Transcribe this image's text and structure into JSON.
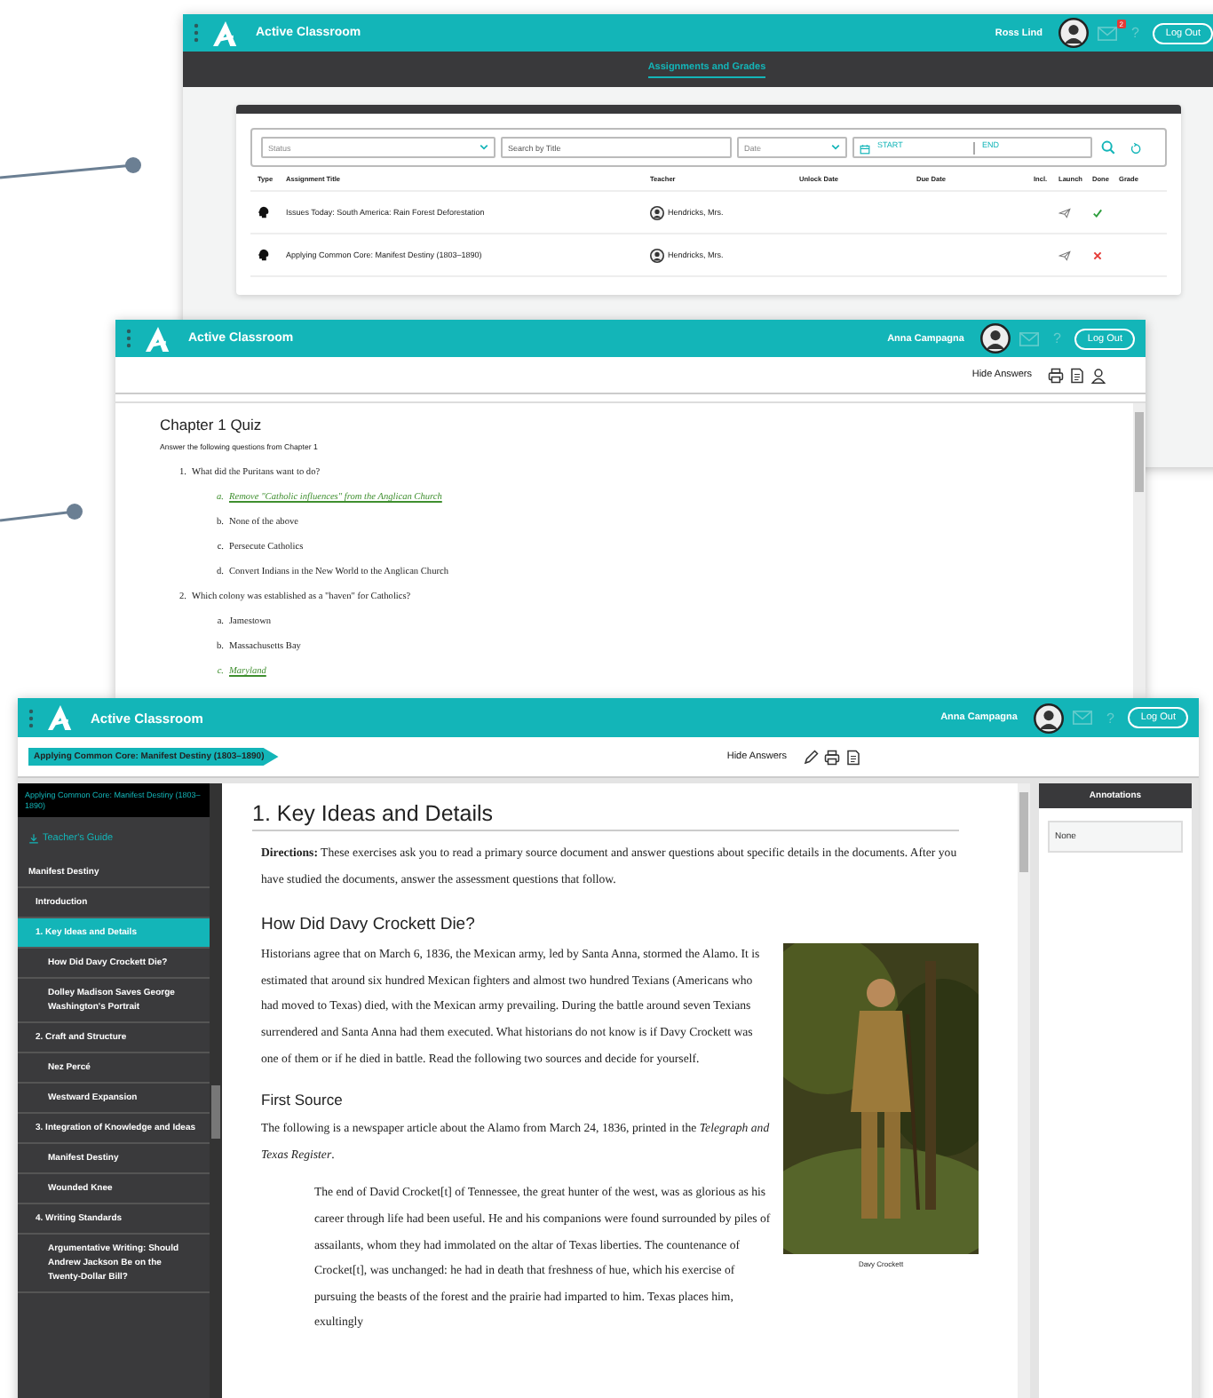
{
  "grades_window": {
    "app_title": "Active Classroom",
    "user_name": "Ross Lind",
    "mail_badge": "2",
    "help": "?",
    "logout": "Log Out",
    "nav_tab": "Assignments and Grades",
    "filters": {
      "status": {
        "placeholder": "Status"
      },
      "search": {
        "placeholder": "Search by Title"
      },
      "date": {
        "placeholder": "Date"
      },
      "start_label": "START",
      "end_label": "END"
    },
    "table": {
      "columns": [
        "Type",
        "Assignment Title",
        "Teacher",
        "Unlock Date",
        "Due Date",
        "Incl.",
        "Launch",
        "Done",
        "Grade"
      ],
      "rows": [
        {
          "title": "Issues Today: South America: Rain Forest Deforestation",
          "teacher": "Hendricks, Mrs.",
          "done": true
        },
        {
          "title": "Applying Common Core: Manifest Destiny (1803–1890)",
          "teacher": "Hendricks, Mrs.",
          "done": false
        }
      ]
    }
  },
  "quiz_window": {
    "app_title": "Active Classroom",
    "user_name": "Anna Campagna",
    "help": "?",
    "logout": "Log Out",
    "hide_answers": "Hide Answers",
    "title": "Chapter 1 Quiz",
    "instructions": "Answer the following questions from Chapter 1",
    "questions": [
      {
        "number": "1.",
        "text": "What did the Puritans want to do?",
        "options": [
          {
            "letter": "a.",
            "text": "Remove \"Catholic influences\" from the Anglican Church",
            "correct": true
          },
          {
            "letter": "b.",
            "text": "None of the above",
            "correct": false
          },
          {
            "letter": "c.",
            "text": "Persecute Catholics",
            "correct": false
          },
          {
            "letter": "d.",
            "text": "Convert Indians in the New World to the Anglican Church",
            "correct": false
          }
        ]
      },
      {
        "number": "2.",
        "text": "Which colony was established as a \"haven\" for Catholics?",
        "options": [
          {
            "letter": "a.",
            "text": "Jamestown",
            "correct": false
          },
          {
            "letter": "b.",
            "text": "Massachusetts Bay",
            "correct": false
          },
          {
            "letter": "c.",
            "text": "Maryland",
            "correct": true
          }
        ]
      }
    ]
  },
  "reader_window": {
    "app_title": "Active Classroom",
    "user_name": "Anna Campagna",
    "help": "?",
    "logout": "Log Out",
    "breadcrumb": "Applying Common Core: Manifest Destiny (1803–1890)",
    "hide_answers": "Hide Answers",
    "sidebar": {
      "book_title": "Applying Common Core: Manifest Destiny (1803–1890)",
      "teachers_guide": "Teacher's Guide",
      "items": [
        {
          "label": "Manifest Destiny",
          "selected": false,
          "children": [
            {
              "label": "Introduction",
              "selected": false
            },
            {
              "label": "1. Key Ideas and Details",
              "selected": true,
              "children": [
                {
                  "label": "How Did Davy Crockett Die?",
                  "selected": false
                },
                {
                  "label": "Dolley Madison Saves George Washington's Portrait",
                  "selected": false
                }
              ]
            },
            {
              "label": "2. Craft and Structure",
              "selected": false,
              "children": [
                {
                  "label": "Nez Percé",
                  "selected": false
                },
                {
                  "label": "Westward Expansion",
                  "selected": false
                }
              ]
            },
            {
              "label": "3. Integration of Knowledge and Ideas",
              "selected": false,
              "children": [
                {
                  "label": "Manifest Destiny",
                  "selected": false
                },
                {
                  "label": "Wounded Knee",
                  "selected": false
                }
              ]
            },
            {
              "label": "4. Writing Standards",
              "selected": false,
              "children": [
                {
                  "label": "Argumentative Writing: Should Andrew Jackson Be on the Twenty-Dollar Bill?",
                  "selected": false
                }
              ]
            }
          ]
        }
      ]
    },
    "article": {
      "title": "1. Key Ideas and Details",
      "directions": "**Directions:** These exercises ask you to read a primary source document and answer questions about specific details in the documents. After you have studied the documents, answer the assessment questions that follow.",
      "section_title": "How Did Davy Crockett Die?",
      "intro": "Historians agree that on March 6, 1836, the Mexican army, led by Santa Anna, stormed the Alamo. It is estimated that around six hundred Mexican fighters and almost two hundred Texians (Americans who had moved to Texas) died, with the Mexican army prevailing. During the battle around seven Texians surrendered and Santa Anna had them executed. What historians do not know is if Davy Crockett was one of them or if he died in battle. Read the following two sources and decide for yourself.",
      "figure_caption": "Davy Crockett",
      "source_title": "First Source",
      "source_intro": "The following is a newspaper article about the Alamo from March 24, 1836, printed in the *Telegraph and Texas Register*.",
      "quote": "The end of David Crocket[t] of Tennessee, the great hunter of the west, was as glorious as his career through life had been useful. He and his companions were found surrounded by piles of assailants, whom they had immolated on the altar of Texas liberties. The countenance of Crocket[t], was unchanged: he had in death that freshness of hue, which his exercise of pursuing the beasts of the forest and the prairie had imparted to him. Texas places him, exultingly"
    },
    "annotations": {
      "title": "Annotations",
      "empty": "None"
    }
  }
}
